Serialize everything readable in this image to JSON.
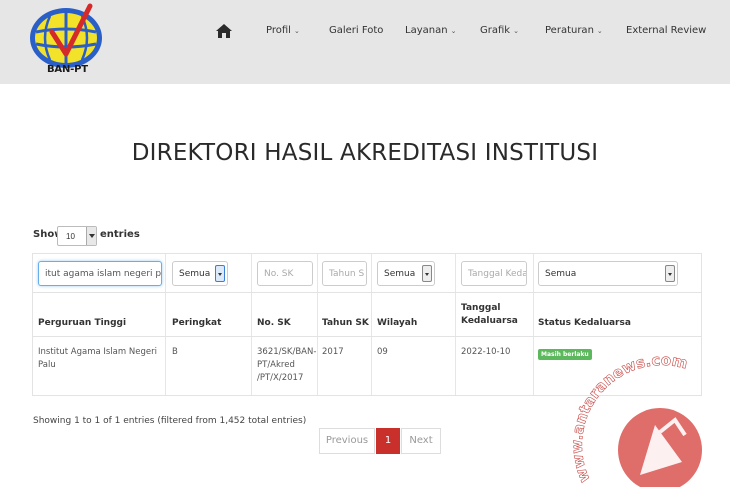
{
  "header": {
    "logo_text": "BAN-PT",
    "nav": [
      {
        "label": "Profil",
        "dropdown": true
      },
      {
        "label": "Galeri Foto",
        "dropdown": false
      },
      {
        "label": "Layanan",
        "dropdown": true
      },
      {
        "label": "Grafik",
        "dropdown": true
      },
      {
        "label": "Peraturan",
        "dropdown": true
      },
      {
        "label": "External Review",
        "dropdown": false
      }
    ],
    "caret": "⌄"
  },
  "page_title": "DIREKTORI HASIL AKREDITASI INSTITUSI",
  "length_control": {
    "prefix": "Show",
    "value": "10",
    "suffix": "entries"
  },
  "filters": {
    "perguruan_tinggi_value": "itut agama islam negeri palu",
    "peringkat_value": "Semua",
    "no_sk_placeholder": "No. SK",
    "tahun_sk_placeholder": "Tahun S",
    "wilayah_value": "Semua",
    "tanggal_placeholder": "Tanggal Keda",
    "status_value": "Semua"
  },
  "columns": [
    "Perguruan Tinggi",
    "Peringkat",
    "No. SK",
    "Tahun SK",
    "Wilayah",
    "Tanggal\nKedaluarsa",
    "Status Kedaluarsa"
  ],
  "rows": [
    {
      "perguruan_tinggi": "Institut Agama Islam Negeri Palu",
      "peringkat": "B",
      "no_sk": "3621/SK/BAN-PT/Akred /PT/X/2017",
      "tahun_sk": "2017",
      "wilayah": "09",
      "tanggal_kedaluarsa": "2022-10-10",
      "status": "Masih berlaku"
    }
  ],
  "info_text": "Showing 1 to 1 of 1 entries (filtered from 1,452 total entries)",
  "pagination": {
    "previous": "Previous",
    "current": "1",
    "next": "Next"
  },
  "watermark": "www.antaranews.com",
  "colors": {
    "active_page": "#c9302c",
    "status_badge": "#5cb85c",
    "header_bg": "#e6e6e6",
    "watermark": "#d9534f"
  }
}
